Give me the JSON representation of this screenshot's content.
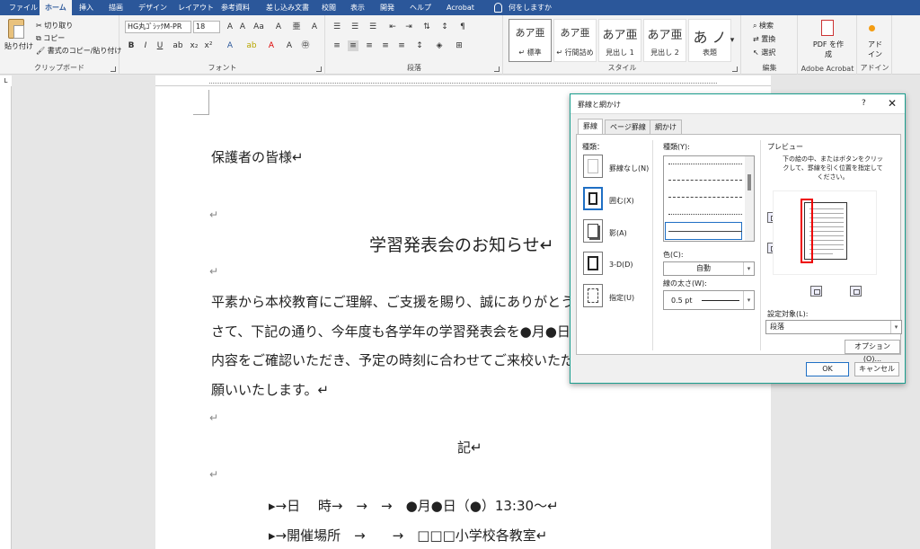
{
  "ribbon_tabs": [
    "ファイル",
    "ホーム",
    "挿入",
    "描画",
    "デザイン",
    "レイアウト",
    "参考資料",
    "差し込み文書",
    "校閲",
    "表示",
    "開発",
    "ヘルプ",
    "Acrobat"
  ],
  "active_tab": "ホーム",
  "tell_me": "何をしますか",
  "clipboard": {
    "paste": "貼り付け",
    "cut": "切り取り",
    "copy": "コピー",
    "format_painter": "書式のコピー/貼り付け",
    "label": "クリップボード"
  },
  "font": {
    "name": "HG丸ｺﾞｼｯｸM-PR",
    "size": "18",
    "label": "フォント"
  },
  "paragraph": {
    "label": "段落"
  },
  "styles": {
    "label": "スタイル",
    "items": [
      {
        "sample": "あア亜",
        "name": "↵ 標準"
      },
      {
        "sample": "あア亜",
        "name": "↵ 行間詰め"
      },
      {
        "sample": "あア亜",
        "name": "見出し 1"
      },
      {
        "sample": "あア亜",
        "name": "見出し 2"
      },
      {
        "sample": "あ ノ",
        "name": "表題"
      }
    ]
  },
  "editing": {
    "label": "編集",
    "find": "検索",
    "replace": "置換",
    "select": "選択"
  },
  "acrobat": {
    "button": "PDF を作成",
    "label": "Adobe Acrobat"
  },
  "addin": {
    "button": "アド イン",
    "label": "アドイン"
  },
  "document": {
    "greeting": "保護者の皆様↵",
    "title": "学習発表会のお知らせ↵",
    "body1": "平素から本校教育にご理解、ご支援を賜り、誠にありがとう",
    "body2": "さて、下記の通り、今年度も各学年の学習発表会を●月●日（",
    "body3": "内容をご確認いただき、予定の時刻に合わせてご来校いただ",
    "body4": "願いいたします。↵",
    "ki": "記↵",
    "item1": "▸→日　 時→　→　→　●月●日（●）13:30～↵",
    "item2": "▸→開催場所　→　　→　□□□小学校各教室↵",
    "para_mark": "↵"
  },
  "dialog": {
    "title": "罫線と網かけ",
    "help": "?",
    "tabs": [
      "罫線",
      "ページ罫線",
      "網かけ"
    ],
    "active_tab": "罫線",
    "setting_label": "種類：",
    "settings": [
      {
        "label": "罫線なし(N)"
      },
      {
        "label": "囲む(X)"
      },
      {
        "label": "影(A)"
      },
      {
        "label": "3-D(D)"
      },
      {
        "label": "指定(U)"
      }
    ],
    "style_label": "種類(Y):",
    "color_label": "色(C):",
    "color_value": "自動",
    "width_label": "線の太さ(W):",
    "width_value": "0.5 pt",
    "preview_label": "プレビュー",
    "preview_hint": "下の絵の中、またはボタンをクリックして、罫線を引く位置を指定してください。",
    "apply_label": "設定対象(L):",
    "apply_value": "段落",
    "options_button": "オプション(O)...",
    "ok_button": "OK",
    "cancel_button": "キャンセル"
  }
}
